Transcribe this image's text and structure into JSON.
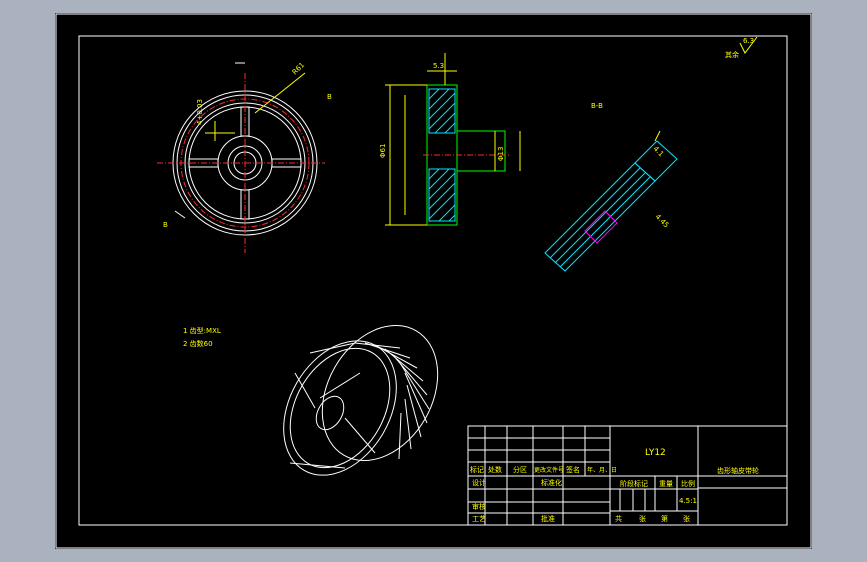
{
  "notes": {
    "line1": "1 齿型:MXL",
    "line2": "2 齿数60"
  },
  "section_label": "B-B",
  "roughness_label": "其余",
  "roughness_value": "6.3",
  "title_block": {
    "material": "LY12",
    "part_name": "齿形轴皮带轮",
    "headers": [
      "标记",
      "处数",
      "分区",
      "更改文件号",
      "签名",
      "年、月、日"
    ],
    "row_design": "设计",
    "row_standard": "标准化",
    "row_review": "审核",
    "row_process": "工艺",
    "row_approve": "批准",
    "stage_label": "阶段标记",
    "weight_label": "重量",
    "scale_label": "比例",
    "scale_value": "4.5:1",
    "sheet_labels": [
      "共",
      "张",
      "第",
      "张"
    ]
  },
  "colors": {
    "background": "#000000",
    "frame": "#ffffff",
    "dimension": "#ffff00",
    "outline": "#00ff00",
    "hatch": "#00e5ff",
    "centerline": "#ff2a2a"
  }
}
